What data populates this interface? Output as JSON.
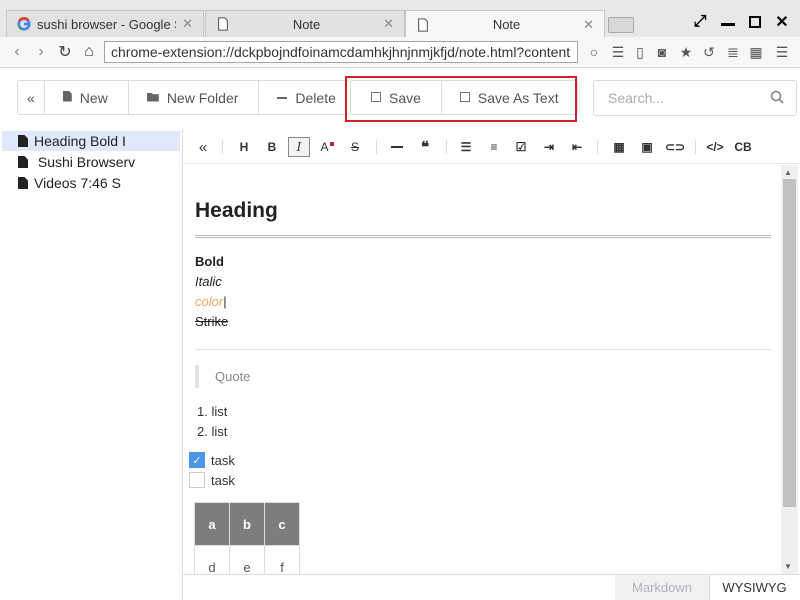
{
  "browser": {
    "tabs": [
      {
        "title": "sushi browser - Google S",
        "active": false,
        "favicon": "google-icon"
      },
      {
        "title": "Note",
        "active": false,
        "favicon": "page-icon"
      },
      {
        "title": "Note",
        "active": true,
        "favicon": "page-icon"
      }
    ],
    "url": "chrome-extension://dckpbojndfoinamcdamhkjhnjnmjkfjd/note.html?content"
  },
  "toolbar": {
    "collapse_label": "«",
    "new_label": "New",
    "new_folder_label": "New Folder",
    "delete_label": "Delete",
    "save_label": "Save",
    "save_as_text_label": "Save As Text",
    "search_placeholder": "Search..."
  },
  "sidebar": {
    "items": [
      {
        "label": "Heading Bold I",
        "selected": true
      },
      {
        "label": " Sushi Browserv",
        "selected": false
      },
      {
        "label": "Videos 7:46 S",
        "selected": false
      }
    ]
  },
  "editor_toolbar": {
    "collapse": "«",
    "heading": "H",
    "bold": "B",
    "italic": "I",
    "text_color": "A",
    "strike": "S",
    "code_block": "CB"
  },
  "document": {
    "heading": "Heading",
    "bold": "Bold",
    "italic": "Italic",
    "color": "color",
    "strike": "Strike",
    "quote": "Quote",
    "ordered_list": [
      "list",
      "list"
    ],
    "tasks": [
      {
        "label": "task",
        "checked": true
      },
      {
        "label": "task",
        "checked": false
      }
    ],
    "table": {
      "headers": [
        "a",
        "b",
        "c"
      ],
      "rows": [
        [
          "d",
          "e",
          "f"
        ]
      ]
    }
  },
  "modes": {
    "markdown": "Markdown",
    "wysiwyg": "WYSIWYG"
  },
  "colors": {
    "highlight": "#d0212a",
    "task_checked": "#4b96e6",
    "color_text": "#f0a860",
    "table_header": "#7d7d7d"
  }
}
